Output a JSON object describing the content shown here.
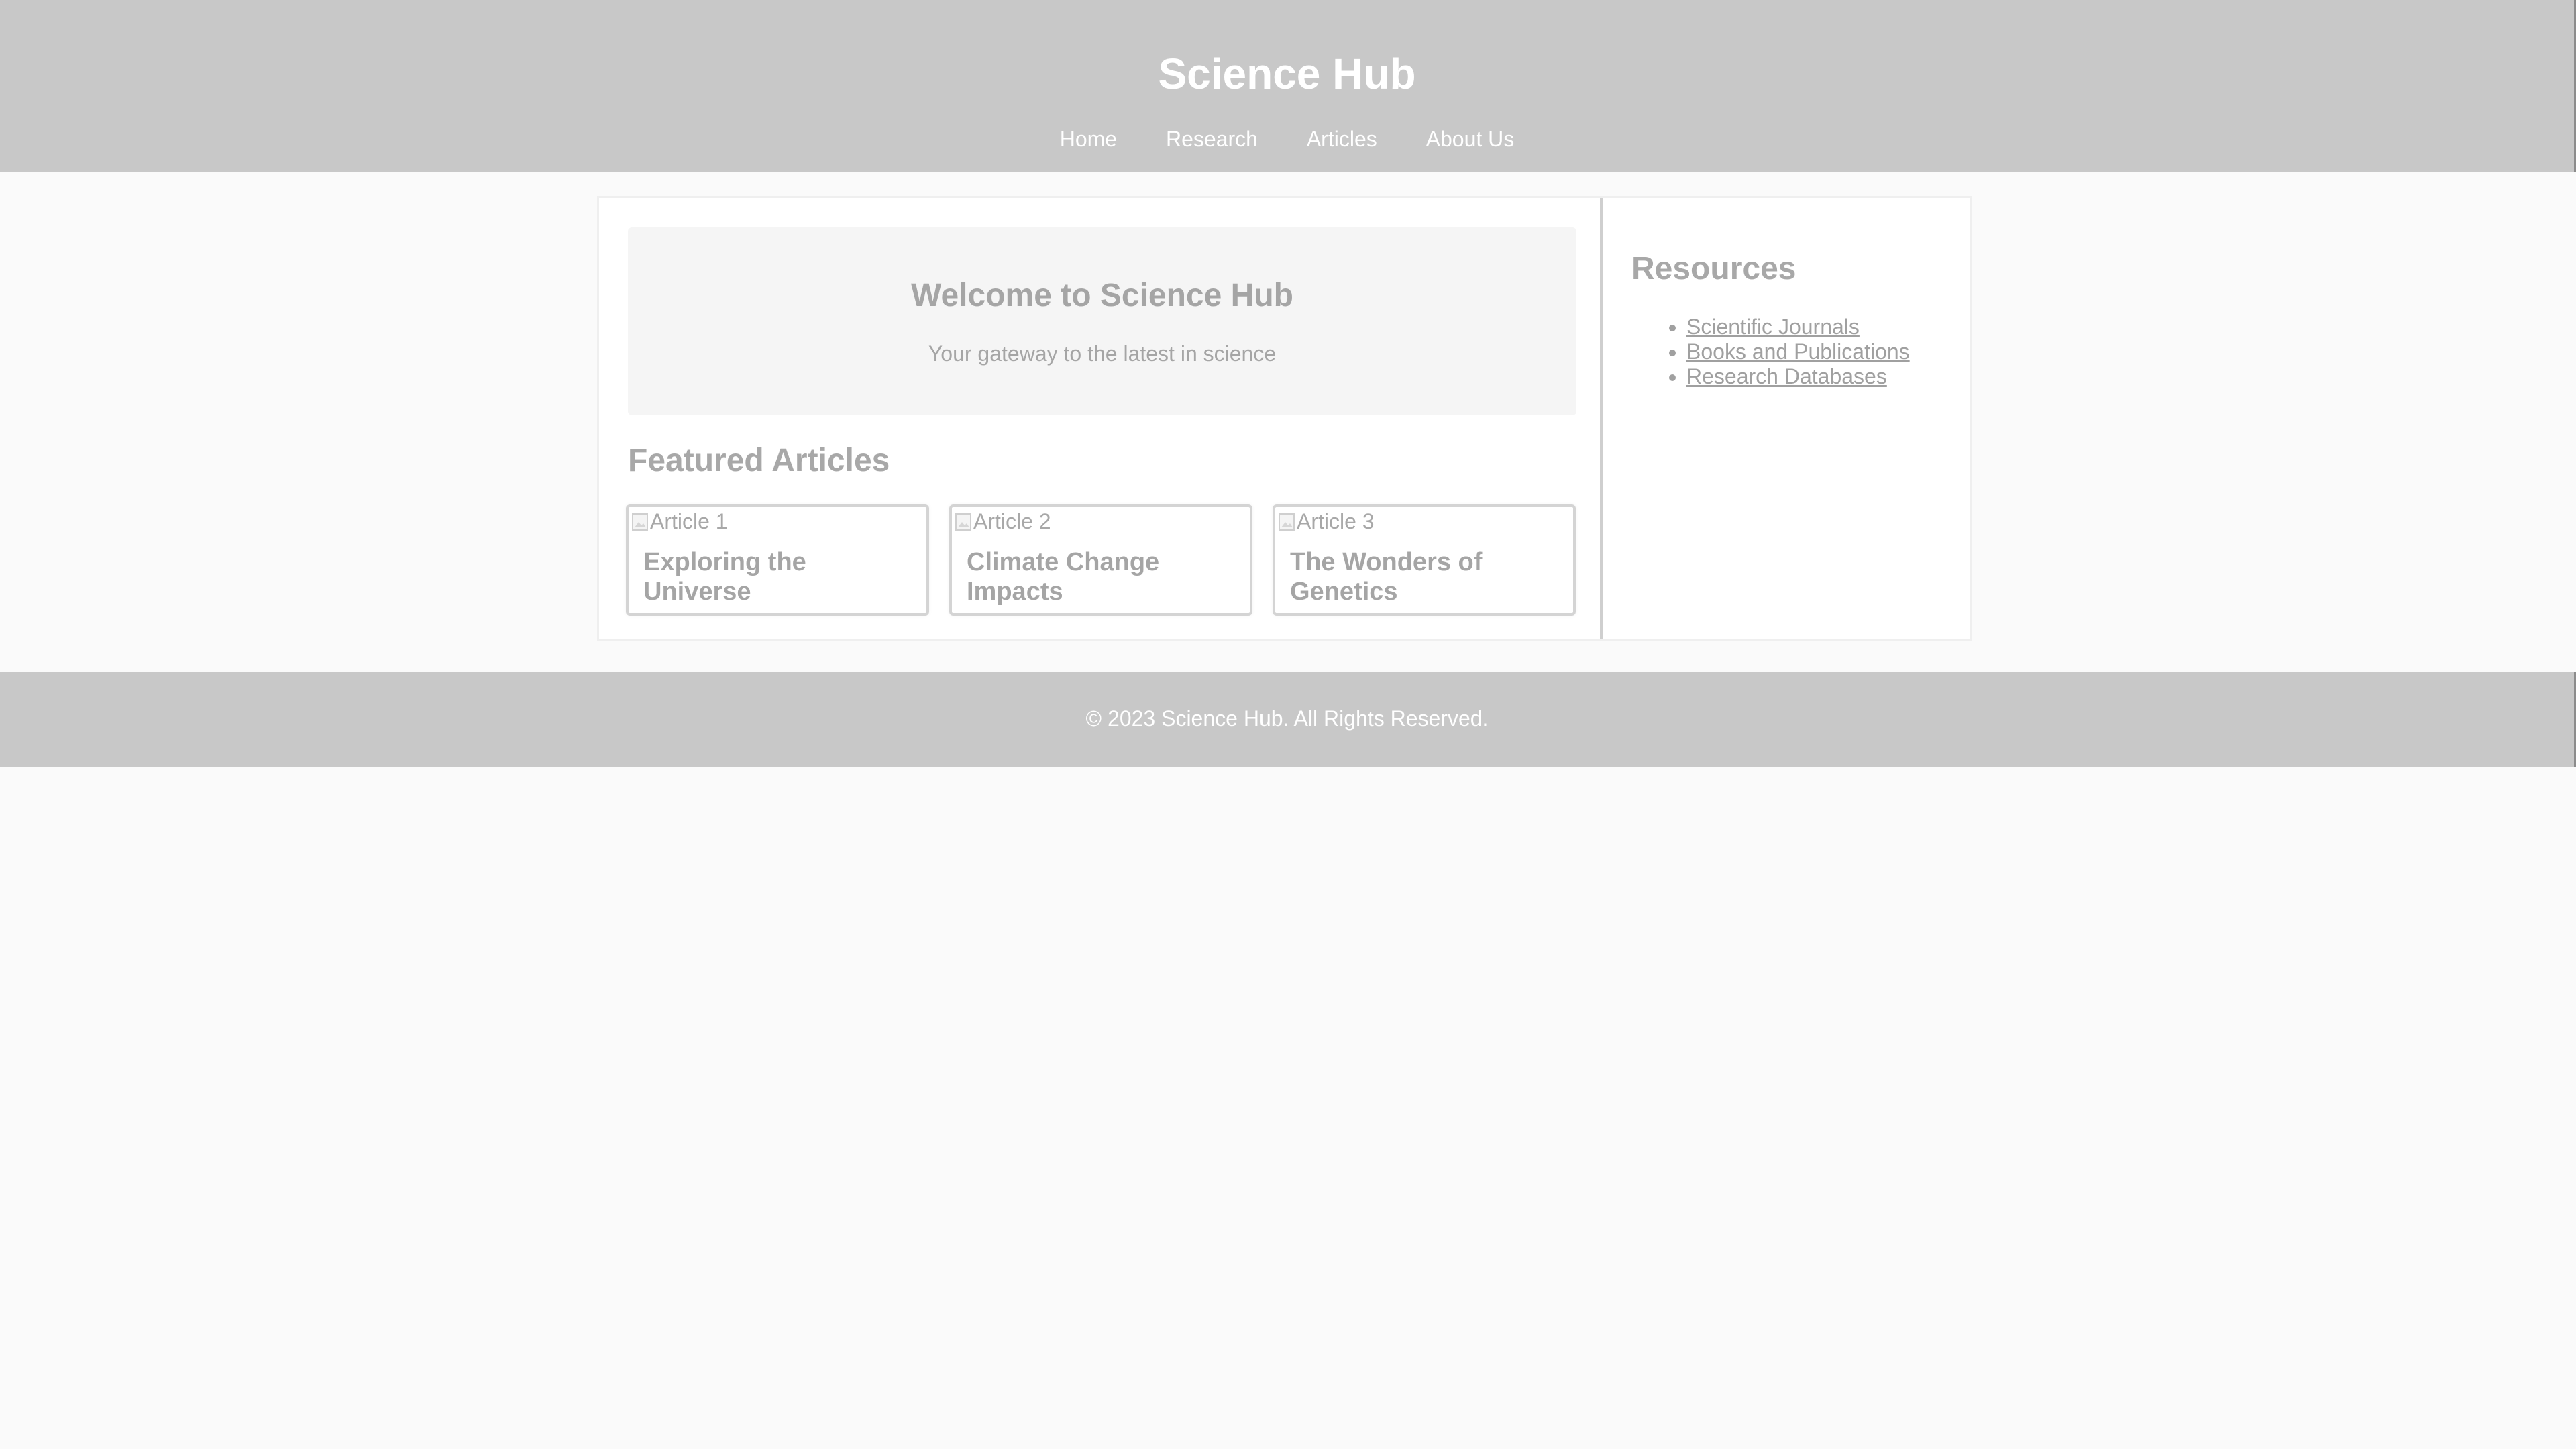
{
  "header": {
    "title": "Science Hub",
    "nav": [
      "Home",
      "Research",
      "Articles",
      "About Us"
    ]
  },
  "welcome": {
    "title": "Welcome to Science Hub",
    "subtitle": "Your gateway to the latest in science"
  },
  "featured": {
    "heading": "Featured Articles",
    "articles": [
      {
        "image_alt": "Article 1",
        "title": "Exploring the Universe"
      },
      {
        "image_alt": "Article 2",
        "title": "Climate Change Impacts"
      },
      {
        "image_alt": "Article 3",
        "title": "The Wonders of Genetics"
      }
    ]
  },
  "sidebar": {
    "heading": "Resources",
    "links": [
      "Scientific Journals",
      "Books and Publications",
      "Research Databases"
    ]
  },
  "footer": {
    "text": "© 2023 Science Hub. All Rights Reserved."
  },
  "colors": {
    "header_bg": "#c8c8c8",
    "page_bg": "#fafafa",
    "panel_bg": "#ffffff",
    "muted_text": "#a0a0a0"
  }
}
